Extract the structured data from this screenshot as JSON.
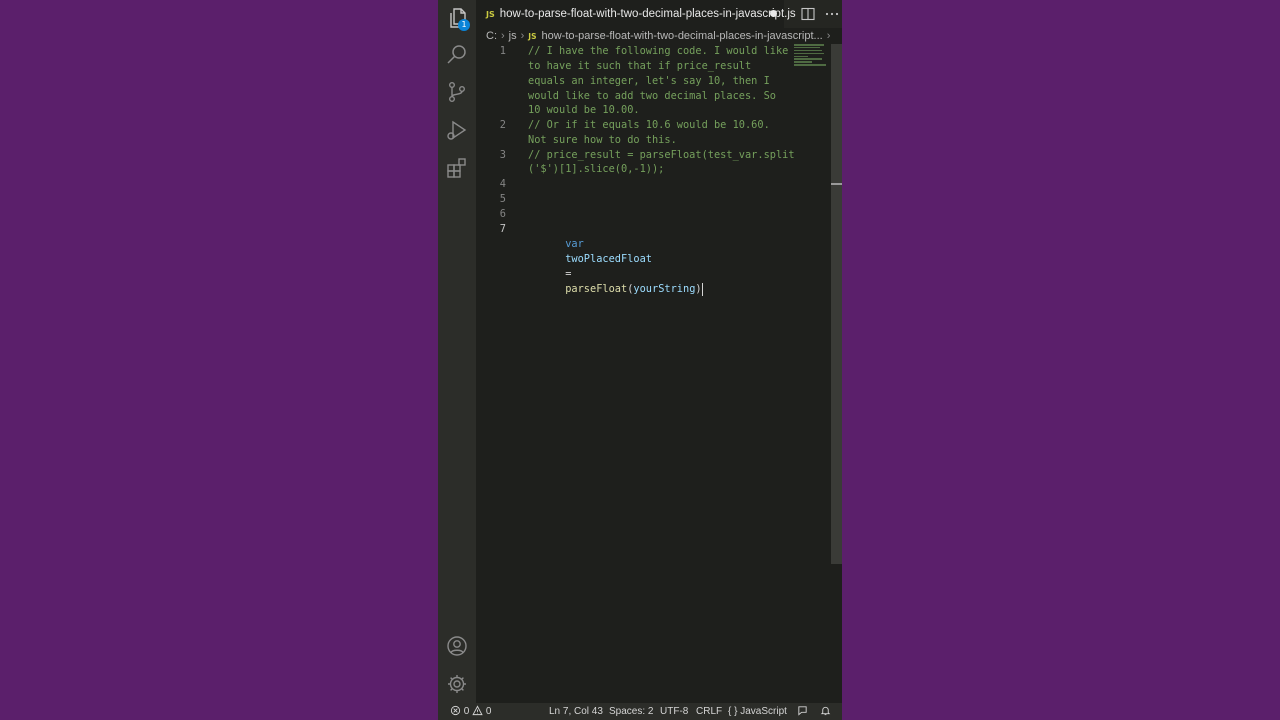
{
  "tab": {
    "file_type_badge": "JS",
    "title": "how-to-parse-float-with-two-decimal-places-in-javascript.js",
    "dirty": true
  },
  "explorer_badge": "1",
  "breadcrumb": {
    "drive": "C:",
    "folder": "js",
    "file_type_badge": "JS",
    "file": "how-to-parse-float-with-two-decimal-places-in-javascript...",
    "more": "..."
  },
  "editor": {
    "line_numbers": [
      "1",
      "2",
      "3",
      "4",
      "5",
      "6",
      "7"
    ],
    "comment_rows": [
      "// I have the following code. I would like",
      "to have it such that if price_result",
      "equals an integer, let's say 10, then I",
      "would like to add two decimal places. So",
      "10 would be 10.00.",
      "// Or if it equals 10.6 would be 10.60.",
      "Not sure how to do this.",
      "// price_result = parseFloat(test_var.split",
      "('$')[1].slice(0,-1));"
    ],
    "code_line_7": {
      "keyword": "var",
      "name": "twoPlacedFloat",
      "op": "=",
      "fn": "parseFloat",
      "open": "(",
      "arg": "yourString",
      "close": ")"
    }
  },
  "status_bar": {
    "errors": "0",
    "warnings": "0",
    "position": "Ln 7, Col 43",
    "spaces": "Spaces: 2",
    "encoding": "UTF-8",
    "eol": "CRLF",
    "language_braces": "{ }",
    "language": "JavaScript"
  },
  "colors": {
    "background": "#5b1f6b",
    "editor_bg": "#1e1f1c",
    "comment": "#75a05c",
    "keyword": "#569cd6",
    "variable": "#9cdcfe",
    "function": "#dcdcaa",
    "badge": "#0a84d8"
  }
}
